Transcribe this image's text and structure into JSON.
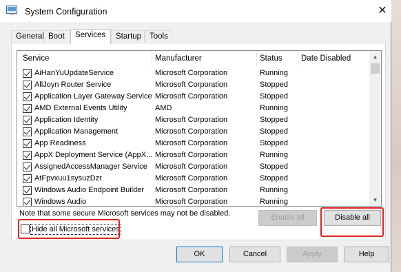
{
  "window": {
    "title": "System Configuration",
    "icon": "msconfig-icon",
    "close_glyph": "✕"
  },
  "tabs": [
    {
      "label": "General",
      "active": false
    },
    {
      "label": "Boot",
      "active": false
    },
    {
      "label": "Services",
      "active": true
    },
    {
      "label": "Startup",
      "active": false
    },
    {
      "label": "Tools",
      "active": false
    }
  ],
  "services_table": {
    "columns": [
      "Service",
      "Manufacturer",
      "Status",
      "Date Disabled"
    ],
    "rows": [
      {
        "checked": true,
        "service": "AiHanYuUpdateService",
        "manufacturer": "Microsoft Corporation",
        "status": "Running",
        "date_disabled": ""
      },
      {
        "checked": true,
        "service": "AllJoyn Router Service",
        "manufacturer": "Microsoft Corporation",
        "status": "Stopped",
        "date_disabled": ""
      },
      {
        "checked": true,
        "service": "Application Layer Gateway Service",
        "manufacturer": "Microsoft Corporation",
        "status": "Stopped",
        "date_disabled": ""
      },
      {
        "checked": true,
        "service": "AMD External Events Utility",
        "manufacturer": "AMD",
        "status": "Running",
        "date_disabled": ""
      },
      {
        "checked": true,
        "service": "Application Identity",
        "manufacturer": "Microsoft Corporation",
        "status": "Stopped",
        "date_disabled": ""
      },
      {
        "checked": true,
        "service": "Application Management",
        "manufacturer": "Microsoft Corporation",
        "status": "Stopped",
        "date_disabled": ""
      },
      {
        "checked": true,
        "service": "App Readiness",
        "manufacturer": "Microsoft Corporation",
        "status": "Stopped",
        "date_disabled": ""
      },
      {
        "checked": true,
        "service": "AppX Deployment Service (AppX...",
        "manufacturer": "Microsoft Corporation",
        "status": "Running",
        "date_disabled": ""
      },
      {
        "checked": true,
        "service": "AssignedAccessManager Service",
        "manufacturer": "Microsoft Corporation",
        "status": "Stopped",
        "date_disabled": ""
      },
      {
        "checked": true,
        "service": "AtFpvxuu1sysuzDzr",
        "manufacturer": "Microsoft Corporation",
        "status": "Stopped",
        "date_disabled": ""
      },
      {
        "checked": true,
        "service": "Windows Audio Endpoint Builder",
        "manufacturer": "Microsoft Corporation",
        "status": "Running",
        "date_disabled": ""
      },
      {
        "checked": true,
        "service": "Windows Audio",
        "manufacturer": "Microsoft Corporation",
        "status": "Running",
        "date_disabled": ""
      }
    ]
  },
  "note": "Note that some secure Microsoft services may not be disabled.",
  "hide_ms_services": {
    "label": "Hide all Microsoft services",
    "checked": false
  },
  "buttons": {
    "enable_all": "Enable all",
    "disable_all": "Disable all",
    "ok": "OK",
    "cancel": "Cancel",
    "apply": "Apply",
    "help": "Help"
  },
  "colors": {
    "highlight_box": "#e2231a",
    "default_button_border": "#0078d7"
  }
}
